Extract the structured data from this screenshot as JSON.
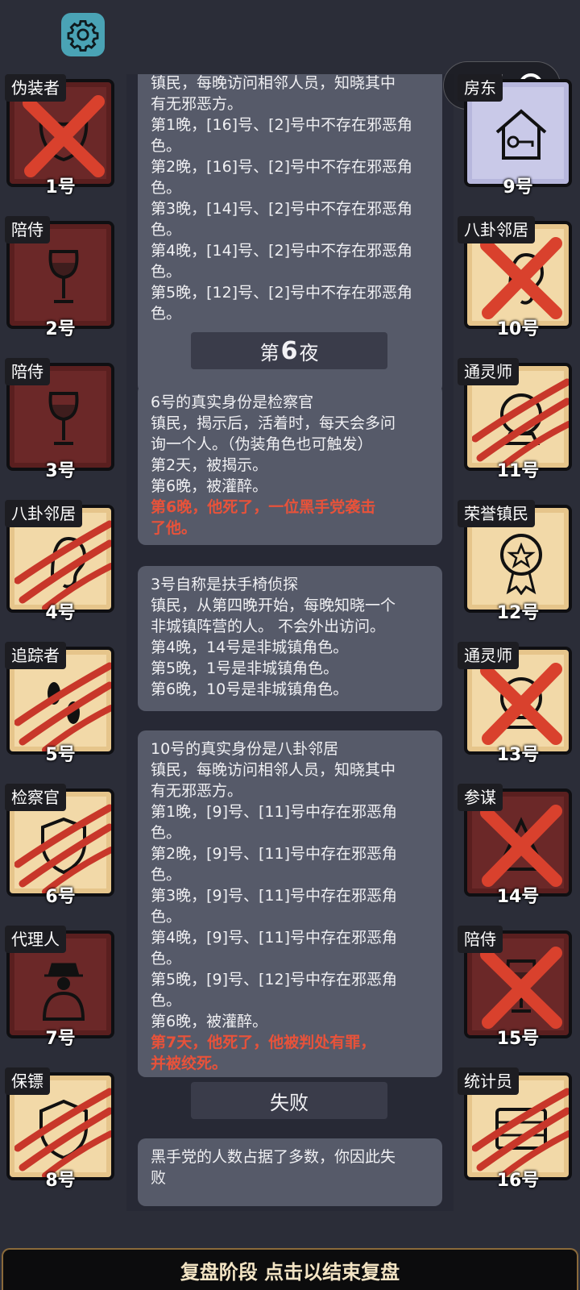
{
  "capsule": {
    "dots": "•••"
  },
  "log": {
    "card1": {
      "lines": [
        "镇民，每晚访问相邻人员，知晓其中",
        "有无邪恶方。",
        "第1晚，[16]号、[2]号中不存在邪恶角",
        "色。",
        "第2晚，[16]号、[2]号中不存在邪恶角",
        "色。",
        "第3晚，[14]号、[2]号中不存在邪恶角",
        "色。",
        "第4晚，[14]号、[2]号中不存在邪恶角",
        "色。",
        "第5晚，[12]号、[2]号中不存在邪恶角",
        "色。"
      ]
    },
    "night_header": {
      "prefix": "第",
      "num": "6",
      "suffix": "夜"
    },
    "card2": {
      "lines": [
        "6号的真实身份是检察官",
        "镇民，揭示后，活着时，每天会多问",
        "询一个人。（伪装角色也可触发）",
        "第2天，被揭示。",
        "第6晚，被灌醉。"
      ],
      "red": [
        "第6晚，他死了，一位黑手党袭击",
        "了他。"
      ]
    },
    "card3": {
      "lines": [
        "3号自称是扶手椅侦探",
        "镇民，从第四晚开始，每晚知晓一个",
        "非城镇阵营的人。 不会外出访问。",
        "第4晚，14号是非城镇角色。",
        "第5晚，1号是非城镇角色。",
        "第6晚，10号是非城镇角色。"
      ]
    },
    "card4": {
      "lines": [
        "10号的真实身份是八卦邻居",
        "镇民，每晚访问相邻人员，知晓其中",
        "有无邪恶方。",
        "第1晚，[9]号、[11]号中存在邪恶角",
        "色。",
        "第2晚，[9]号、[11]号中存在邪恶角",
        "色。",
        "第3晚，[9]号、[11]号中存在邪恶角",
        "色。",
        "第4晚，[9]号、[11]号中存在邪恶角",
        "色。",
        "第5晚，[9]号、[12]号中存在邪恶角",
        "色。",
        "第6晚，被灌醉。"
      ],
      "red": [
        "第7天，他死了，他被判处有罪，",
        "并被绞死。"
      ]
    },
    "result_header": "失败",
    "card5": {
      "lines": [
        "黑手党的人数占据了多数，你因此失",
        "败"
      ]
    }
  },
  "players_left": [
    {
      "role": "伪装者",
      "num": "1号",
      "bg": "dark",
      "mark": "x",
      "icon": "mask-icon"
    },
    {
      "role": "陪侍",
      "num": "2号",
      "bg": "dark",
      "mark": "none",
      "icon": "wine-glass-icon"
    },
    {
      "role": "陪侍",
      "num": "3号",
      "bg": "dark",
      "mark": "none",
      "icon": "wine-glass-icon"
    },
    {
      "role": "八卦邻居",
      "num": "4号",
      "bg": "light",
      "mark": "claw",
      "icon": "ear-icon"
    },
    {
      "role": "追踪者",
      "num": "5号",
      "bg": "light",
      "mark": "claw",
      "icon": "footprints-icon"
    },
    {
      "role": "检察官",
      "num": "6号",
      "bg": "light",
      "mark": "claw",
      "icon": "shield-icon"
    },
    {
      "role": "代理人",
      "num": "7号",
      "bg": "dark",
      "mark": "none",
      "icon": "agent-icon"
    },
    {
      "role": "保镖",
      "num": "8号",
      "bg": "light",
      "mark": "claw",
      "icon": "guard-shield-icon"
    }
  ],
  "players_right": [
    {
      "role": "房东",
      "num": "9号",
      "bg": "lilac",
      "mark": "none",
      "icon": "house-key-icon"
    },
    {
      "role": "八卦邻居",
      "num": "10号",
      "bg": "light",
      "mark": "x",
      "icon": "ear-icon"
    },
    {
      "role": "通灵师",
      "num": "11号",
      "bg": "light",
      "mark": "claw",
      "icon": "crystal-ball-icon"
    },
    {
      "role": "荣誉镇民",
      "num": "12号",
      "bg": "light",
      "mark": "none",
      "icon": "medal-icon"
    },
    {
      "role": "通灵师",
      "num": "13号",
      "bg": "light",
      "mark": "x",
      "icon": "crystal-ball-icon"
    },
    {
      "role": "参谋",
      "num": "14号",
      "bg": "dark",
      "mark": "x",
      "icon": "pyramid-icon"
    },
    {
      "role": "陪侍",
      "num": "15号",
      "bg": "dark",
      "mark": "x",
      "icon": "wine-glass-icon"
    },
    {
      "role": "统计员",
      "num": "16号",
      "bg": "light",
      "mark": "claw",
      "icon": "abacus-icon"
    }
  ],
  "bottom_bar": {
    "label": "复盘阶段 点击以结束复盘"
  },
  "colors": {
    "red_text": "#e8523a",
    "x_mark": "#d9412d",
    "gear_bg": "#4aa3b5"
  }
}
